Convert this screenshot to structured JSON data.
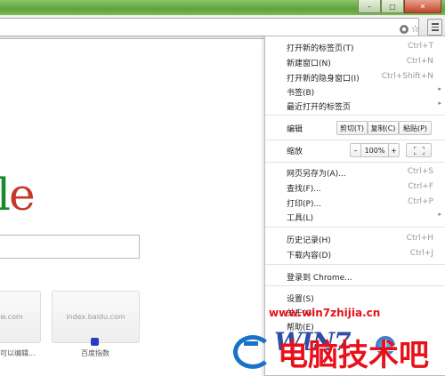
{
  "window": {
    "controls": [
      {
        "name": "minimize",
        "glyph": "–"
      },
      {
        "name": "maximize",
        "glyph": "▢"
      },
      {
        "name": "close",
        "glyph": "✕"
      }
    ]
  },
  "toolbar": {
    "icons": [
      "page-info-icon",
      "star-icon",
      "menu-icon"
    ]
  },
  "page": {
    "logo_text": "le",
    "logo_colors": [
      "#1a8a2e",
      "#c3382a"
    ],
    "tiles": [
      {
        "label": "w.com",
        "caption": "可以编辑..."
      },
      {
        "label": "index.baidu.com",
        "caption": "百度指数"
      }
    ]
  },
  "menu": {
    "new_tab": {
      "label": "打开新的标签页(T)",
      "shortcut": "Ctrl+T"
    },
    "new_window": {
      "label": "新建窗口(N)",
      "shortcut": "Ctrl+N"
    },
    "new_incognito": {
      "label": "打开新的隐身窗口(I)",
      "shortcut": "Ctrl+Shift+N"
    },
    "bookmarks": {
      "label": "书签(B)"
    },
    "recent_tabs": {
      "label": "最近打开的标签页"
    },
    "edit": {
      "label": "编辑",
      "cut": "剪切(T)",
      "copy": "复制(C)",
      "paste": "粘贴(P)"
    },
    "zoom": {
      "label": "缩放",
      "minus": "–",
      "value": "100%",
      "plus": "+"
    },
    "save_page": {
      "label": "网页另存为(A)...",
      "shortcut": "Ctrl+S"
    },
    "find": {
      "label": "查找(F)...",
      "shortcut": "Ctrl+F"
    },
    "print": {
      "label": "打印(P)...",
      "shortcut": "Ctrl+P"
    },
    "tools": {
      "label": "工具(L)"
    },
    "history": {
      "label": "历史记录(H)",
      "shortcut": "Ctrl+H"
    },
    "downloads": {
      "label": "下载内容(D)",
      "shortcut": "Ctrl+J"
    },
    "signin": {
      "label": "登录到 Chrome..."
    },
    "settings": {
      "label": "设置(S)"
    },
    "about": {
      "label": "关于(G)"
    },
    "help": {
      "label": "帮助(E)"
    },
    "arrow": "▸"
  },
  "watermark": {
    "url": "www.win7zhijia.cn",
    "logo": "WIN7",
    "site": "电脑技术吧",
    "colors": {
      "red": "#e8101a",
      "blue": "#2d4ea3"
    }
  }
}
